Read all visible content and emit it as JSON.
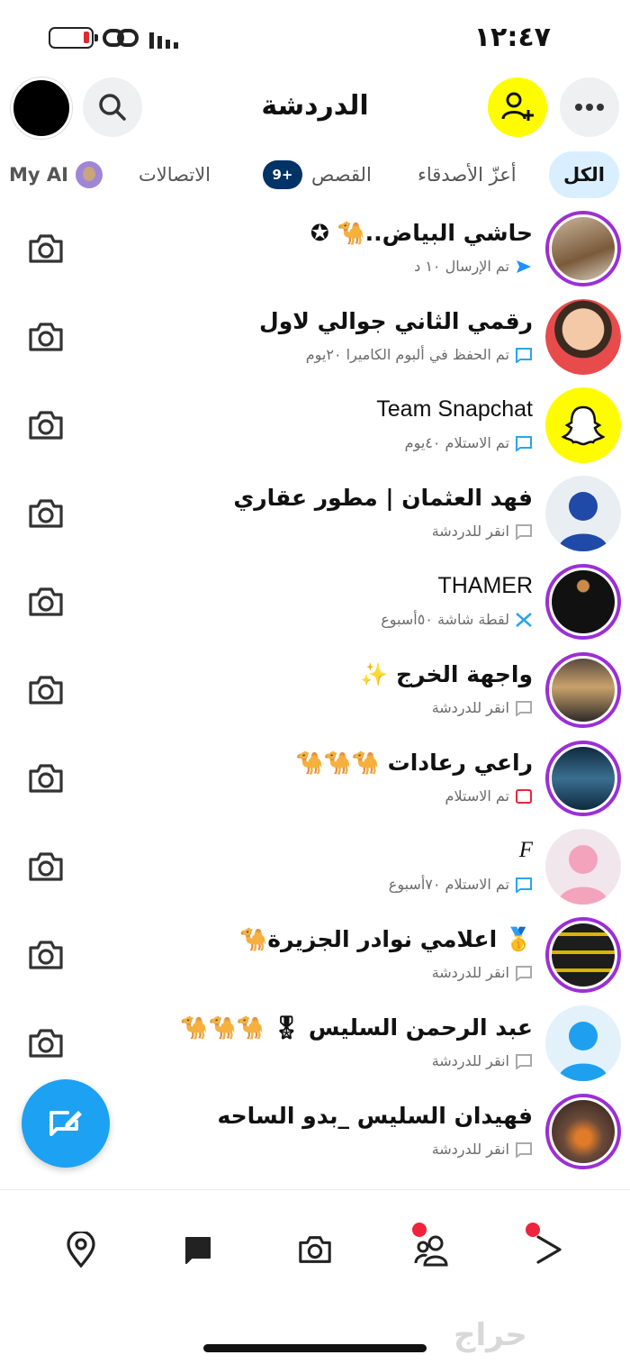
{
  "status_bar": {
    "time": "١٢:٤٧",
    "battery_color": "#e0282e"
  },
  "header": {
    "title": "الدردشة",
    "search_icon": "search-icon",
    "add_friend_icon": "add-friend-icon",
    "more_icon": "more-icon"
  },
  "tabs": {
    "all": "الكل",
    "bff": "أعزّ الأصدقاء",
    "stories": "القصص",
    "stories_count": "9+",
    "contacts": "الاتصالات",
    "my_ai": "My AI"
  },
  "chats": [
    {
      "name": "حاشي البياض..🐪 ✪",
      "status": "تم الإرسال ١٠ د",
      "status_type": "sent"
    },
    {
      "name": "رقمي الثاني جوالي لاول",
      "status": "تم الحفظ في ألبوم الكاميرا ٢٠يوم",
      "status_type": "saved"
    },
    {
      "name": "Team Snapchat",
      "status": "تم الاستلام ٤٠يوم",
      "status_type": "received-chat"
    },
    {
      "name": "فهد العثمان | مطور عقاري",
      "status": "انقر للدردشة",
      "status_type": "tap"
    },
    {
      "name": "THAMER",
      "status": "لقطة شاشة ٥٠أسبوع",
      "status_type": "screenshot"
    },
    {
      "name": "واجهة الخرج ✨",
      "status": "انقر للدردشة",
      "status_type": "tap"
    },
    {
      "name": "راعي رعادات 🐪🐪🐪",
      "status": "تم الاستلام",
      "status_type": "received-snap"
    },
    {
      "name": "F",
      "status": "تم الاستلام ٧٠أسبوع",
      "status_type": "received-chat"
    },
    {
      "name": "🥇 اعلامي نوادر الجزيرة🐪",
      "status": "انقر للدردشة",
      "status_type": "tap"
    },
    {
      "name": "عبد الرحمن السليس 🎖 🐪🐪🐪",
      "status": "انقر للدردشة",
      "status_type": "tap"
    },
    {
      "name": "فهيدان السليس _بدو الساحه",
      "status": "انقر للدردشة",
      "status_type": "tap"
    }
  ],
  "colors": {
    "accent_blue": "#1da1f2",
    "snap_yellow": "#fffc00",
    "story_ring": "#9b2fd6",
    "received_snap_red": "#ef233c",
    "chat_blue": "#2aa4ee"
  },
  "watermark": "حراج"
}
